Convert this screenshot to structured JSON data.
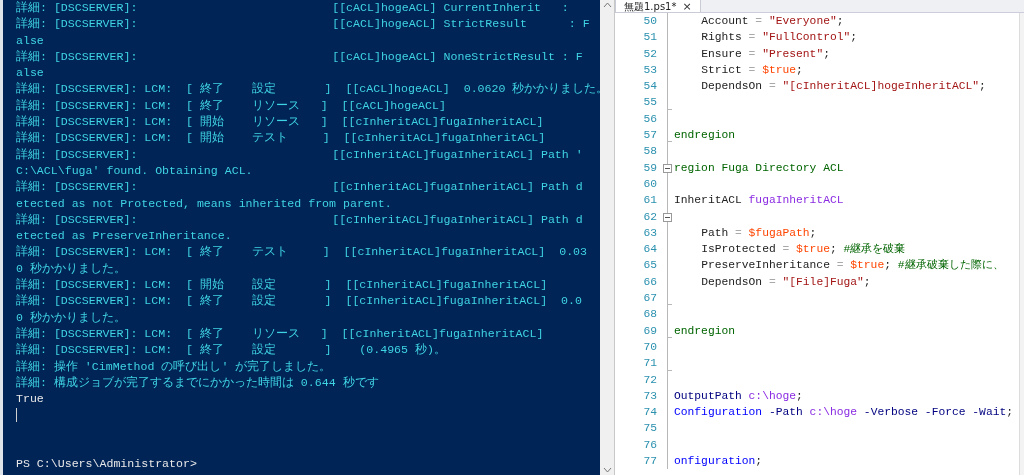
{
  "console": {
    "lines": [
      {
        "kind": "verbose",
        "text": "詳細: [DSCSERVER]:                            [[cACL]hogeACL] CurrentInherit   :"
      },
      {
        "kind": "verbose",
        "text": "詳細: [DSCSERVER]:                            [[cACL]hogeACL] StrictResult      : F"
      },
      {
        "kind": "verbose",
        "text": "alse"
      },
      {
        "kind": "verbose",
        "text": "詳細: [DSCSERVER]:                            [[cACL]hogeACL] NoneStrictResult : F"
      },
      {
        "kind": "verbose",
        "text": "alse"
      },
      {
        "kind": "verbose",
        "text": "詳細: [DSCSERVER]: LCM:  [ 終了    設定       ]  [[cACL]hogeACL]  0.0620 秒かかりました。"
      },
      {
        "kind": "verbose",
        "text": "詳細: [DSCSERVER]: LCM:  [ 終了    リソース   ]  [[cACL]hogeACL]"
      },
      {
        "kind": "verbose",
        "text": "詳細: [DSCSERVER]: LCM:  [ 開始    リソース   ]  [[cInheritACL]fugaInheritACL]"
      },
      {
        "kind": "verbose",
        "text": "詳細: [DSCSERVER]: LCM:  [ 開始    テスト     ]  [[cInheritACL]fugaInheritACL]"
      },
      {
        "kind": "verbose",
        "text": "詳細: [DSCSERVER]:                            [[cInheritACL]fugaInheritACL] Path '"
      },
      {
        "kind": "verbose",
        "text": "C:\\ACL\\fuga' found. Obtaining ACL."
      },
      {
        "kind": "verbose",
        "text": "詳細: [DSCSERVER]:                            [[cInheritACL]fugaInheritACL] Path d"
      },
      {
        "kind": "verbose",
        "text": "etected as not Protected, means inherited from parent."
      },
      {
        "kind": "verbose",
        "text": "詳細: [DSCSERVER]:                            [[cInheritACL]fugaInheritACL] Path d"
      },
      {
        "kind": "verbose",
        "text": "etected as PreserveInheritance."
      },
      {
        "kind": "verbose",
        "text": "詳細: [DSCSERVER]: LCM:  [ 終了    テスト     ]  [[cInheritACL]fugaInheritACL]  0.03"
      },
      {
        "kind": "verbose",
        "text": "0 秒かかりました。"
      },
      {
        "kind": "verbose",
        "text": "詳細: [DSCSERVER]: LCM:  [ 開始    設定       ]  [[cInheritACL]fugaInheritACL]"
      },
      {
        "kind": "verbose",
        "text": "詳細: [DSCSERVER]: LCM:  [ 終了    設定       ]  [[cInheritACL]fugaInheritACL]  0.0"
      },
      {
        "kind": "verbose",
        "text": "0 秒かかりました。"
      },
      {
        "kind": "verbose",
        "text": "詳細: [DSCSERVER]: LCM:  [ 終了    リソース   ]  [[cInheritACL]fugaInheritACL]"
      },
      {
        "kind": "verbose",
        "text": "詳細: [DSCSERVER]: LCM:  [ 終了    設定       ]    (0.4965 秒)。"
      },
      {
        "kind": "verbose",
        "text": "詳細: 操作 'CimMethod の呼び出し' が完了しました。"
      },
      {
        "kind": "verbose",
        "text": "詳細: 構成ジョブが完了するまでにかかった時間は 0.644 秒です"
      },
      {
        "kind": "output",
        "text": "True"
      },
      {
        "kind": "cursor"
      },
      {
        "kind": "blank"
      },
      {
        "kind": "blank"
      },
      {
        "kind": "output",
        "text": "PS C:\\Users\\Administrator>"
      }
    ]
  },
  "editor": {
    "tab": {
      "title": "無題1.ps1*",
      "close": "×"
    },
    "lines": [
      {
        "number": "50",
        "tokens": [
          {
            "kind": "plain",
            "text": "    Account"
          },
          {
            "kind": "op",
            "text": " = "
          },
          {
            "kind": "string",
            "text": "\"Everyone\""
          },
          {
            "kind": "plain",
            "text": ";"
          }
        ]
      },
      {
        "number": "51",
        "tokens": [
          {
            "kind": "plain",
            "text": "    Rights"
          },
          {
            "kind": "op",
            "text": " = "
          },
          {
            "kind": "string",
            "text": "\"FullControl\""
          },
          {
            "kind": "plain",
            "text": ";"
          }
        ]
      },
      {
        "number": "52",
        "tokens": [
          {
            "kind": "plain",
            "text": "    Ensure"
          },
          {
            "kind": "op",
            "text": " = "
          },
          {
            "kind": "string",
            "text": "\"Present\""
          },
          {
            "kind": "plain",
            "text": ";"
          }
        ]
      },
      {
        "number": "53",
        "tokens": [
          {
            "kind": "plain",
            "text": "    Strict"
          },
          {
            "kind": "op",
            "text": " = "
          },
          {
            "kind": "variable",
            "text": "$true"
          },
          {
            "kind": "plain",
            "text": ";"
          }
        ]
      },
      {
        "number": "54",
        "tokens": [
          {
            "kind": "plain",
            "text": "    DependsOn"
          },
          {
            "kind": "op",
            "text": " = "
          },
          {
            "kind": "string",
            "text": "\"[cInheritACL]hogeInheritACL\""
          },
          {
            "kind": "plain",
            "text": ";"
          }
        ]
      },
      {
        "number": "55",
        "fold_end": true
      },
      {
        "number": "56"
      },
      {
        "number": "57",
        "fold_end": true,
        "tokens": [
          {
            "kind": "comment",
            "text": "endregion"
          }
        ]
      },
      {
        "number": "58"
      },
      {
        "number": "59",
        "fold_start": true,
        "tokens": [
          {
            "kind": "comment",
            "text": "region Fuga Directory ACL"
          }
        ]
      },
      {
        "number": "60"
      },
      {
        "number": "61",
        "tokens": [
          {
            "kind": "plain",
            "text": "InheritACL "
          },
          {
            "kind": "name",
            "text": "fugaInheritACL"
          }
        ]
      },
      {
        "number": "62",
        "fold_start": true
      },
      {
        "number": "63",
        "tokens": [
          {
            "kind": "plain",
            "text": "    Path"
          },
          {
            "kind": "op",
            "text": " = "
          },
          {
            "kind": "variable",
            "text": "$fugaPath"
          },
          {
            "kind": "plain",
            "text": ";"
          }
        ]
      },
      {
        "number": "64",
        "tokens": [
          {
            "kind": "plain",
            "text": "    IsProtected"
          },
          {
            "kind": "op",
            "text": " = "
          },
          {
            "kind": "variable",
            "text": "$true"
          },
          {
            "kind": "plain",
            "text": "; "
          },
          {
            "kind": "comment",
            "text": "#継承を破棄"
          }
        ]
      },
      {
        "number": "65",
        "tokens": [
          {
            "kind": "plain",
            "text": "    PreserveInheritance"
          },
          {
            "kind": "op",
            "text": " = "
          },
          {
            "kind": "variable",
            "text": "$true"
          },
          {
            "kind": "plain",
            "text": "; "
          },
          {
            "kind": "comment",
            "text": "#継承破棄した際に、"
          }
        ]
      },
      {
        "number": "66",
        "tokens": [
          {
            "kind": "plain",
            "text": "    DependsOn"
          },
          {
            "kind": "op",
            "text": " = "
          },
          {
            "kind": "string",
            "text": "\"[File]Fuga\""
          },
          {
            "kind": "plain",
            "text": ";"
          }
        ]
      },
      {
        "number": "67",
        "fold_end": true
      },
      {
        "number": "68"
      },
      {
        "number": "69",
        "fold_end": true,
        "tokens": [
          {
            "kind": "comment",
            "text": "endregion"
          }
        ]
      },
      {
        "number": "70"
      },
      {
        "number": "71",
        "fold_end": true
      },
      {
        "number": "72"
      },
      {
        "number": "73",
        "tokens": [
          {
            "kind": "param",
            "text": "OutputPath "
          },
          {
            "kind": "name",
            "text": "c:\\hoge"
          },
          {
            "kind": "plain",
            "text": ";"
          }
        ]
      },
      {
        "number": "74",
        "tokens": [
          {
            "kind": "command",
            "text": "Configuration"
          },
          {
            "kind": "param",
            "text": " -Path "
          },
          {
            "kind": "name",
            "text": "c:\\hoge"
          },
          {
            "kind": "param",
            "text": " -Verbose -Force -Wait"
          },
          {
            "kind": "plain",
            "text": ";"
          }
        ]
      },
      {
        "number": "75"
      },
      {
        "number": "76"
      },
      {
        "number": "77",
        "tokens": [
          {
            "kind": "command",
            "text": "onfiguration"
          },
          {
            "kind": "plain",
            "text": ";"
          }
        ]
      }
    ]
  }
}
